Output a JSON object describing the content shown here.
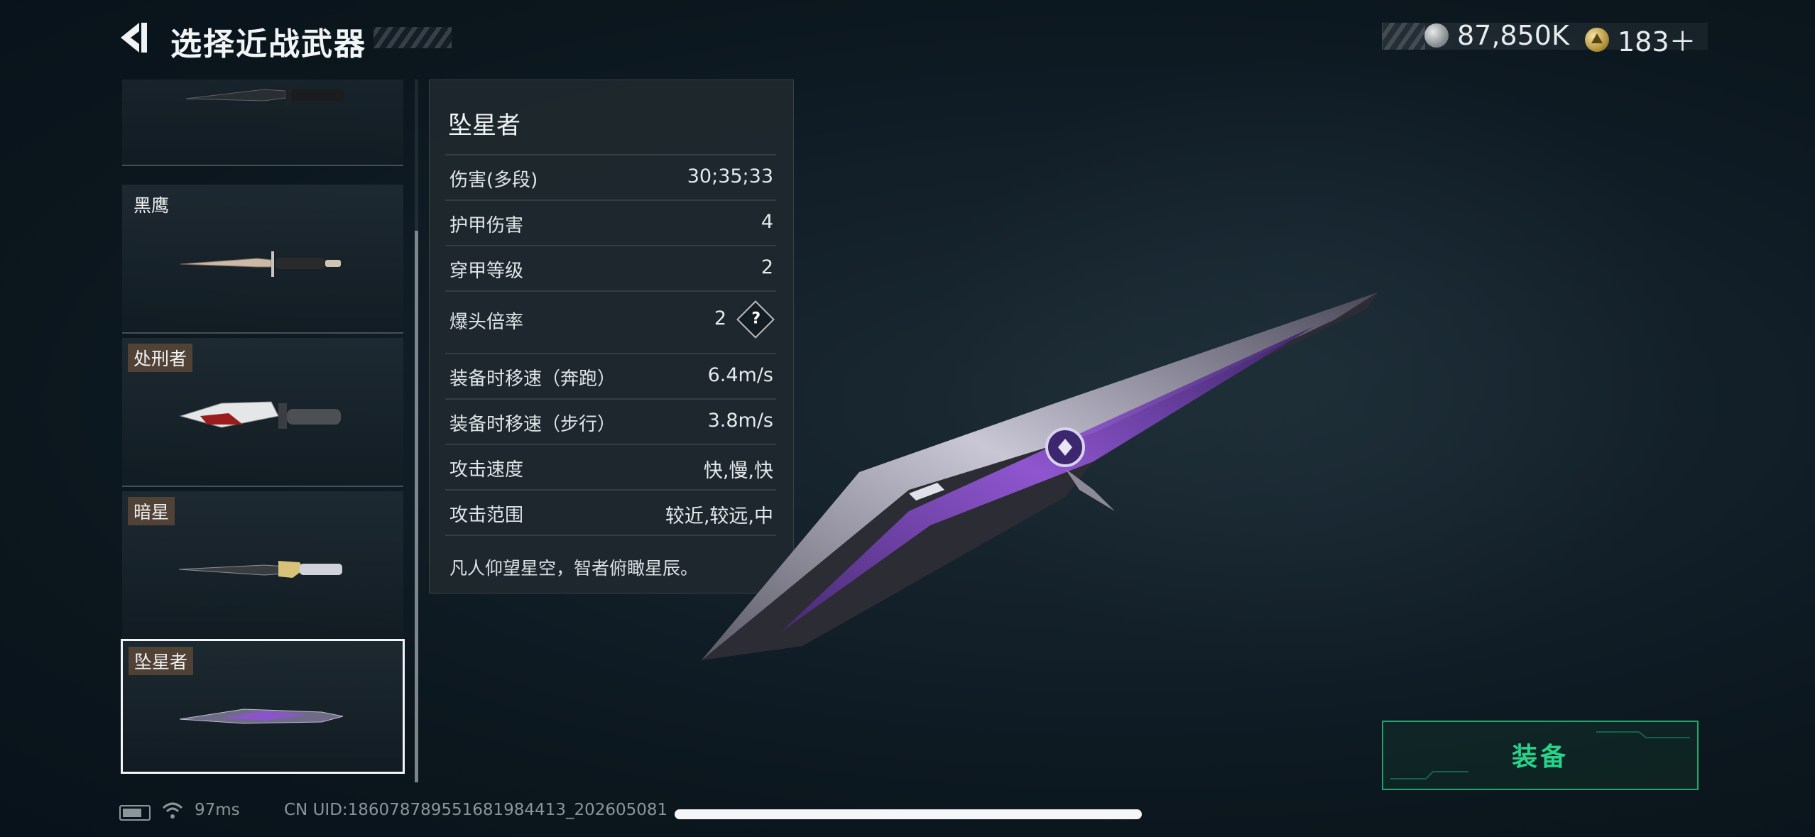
{
  "header": {
    "title": "选择近战武器",
    "currencies": [
      {
        "icon": "silver-coin-icon",
        "value": "87,850K"
      },
      {
        "icon": "gold-coin-icon",
        "value": "183＋"
      }
    ]
  },
  "weapon_list": [
    {
      "name": "",
      "icon": "combat-knife-icon"
    },
    {
      "name": "黑鹰",
      "icon": "dagger-icon"
    },
    {
      "name": "处刑者",
      "icon": "serrated-knife-icon"
    },
    {
      "name": "暗星",
      "icon": "ornate-blade-icon"
    },
    {
      "name": "坠星者",
      "icon": "purple-blade-icon",
      "selected": true
    }
  ],
  "stats": {
    "name": "坠星者",
    "rows": [
      {
        "label": "伤害(多段)",
        "value": "30;35;33"
      },
      {
        "label": "护甲伤害",
        "value": "4"
      },
      {
        "label": "穿甲等级",
        "value": "2"
      },
      {
        "label": "爆头倍率",
        "value": "2",
        "help": "?"
      },
      {
        "label": "装备时移速（奔跑）",
        "value": "6.4m/s"
      },
      {
        "label": "装备时移速（步行）",
        "value": "3.8m/s"
      },
      {
        "label": "攻击速度",
        "value": "快,慢,快"
      },
      {
        "label": "攻击范围",
        "value": "较近,较远,中"
      }
    ],
    "description": "凡人仰望星空，智者俯瞰星辰。"
  },
  "equip_button": {
    "label": "装备"
  },
  "footer": {
    "ping": "97ms",
    "uid": "CN UID:18607878955168198441​3_202605081​"
  },
  "colors": {
    "accent_green": "#28d38a",
    "panel_bg": "#1e282e",
    "text": "#e8eef0"
  }
}
